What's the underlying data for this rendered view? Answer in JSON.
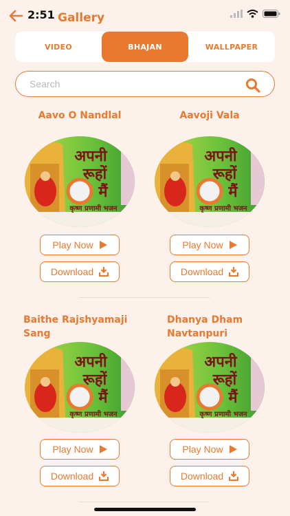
{
  "status": {
    "time": "2:51"
  },
  "header": {
    "title": "Gallery"
  },
  "tabs": [
    {
      "label": "VIDEO",
      "active": false
    },
    {
      "label": "BHAJAN",
      "active": true
    },
    {
      "label": "WALLPAPER",
      "active": false
    }
  ],
  "search": {
    "placeholder": "Search",
    "value": ""
  },
  "items": [
    {
      "title": "Aavo O Nandlal",
      "play_label": "Play Now",
      "download_label": "Download"
    },
    {
      "title": "Aavoji Vala",
      "play_label": "Play Now",
      "download_label": "Download"
    },
    {
      "title": "Baithe Rajshyamaji Sang",
      "play_label": "Play Now",
      "download_label": "Download"
    },
    {
      "title": "Dhanya Dham Navtanpuri",
      "play_label": "Play Now",
      "download_label": "Download"
    }
  ],
  "cover": {
    "line1": "अपनी",
    "line2": "रूहों",
    "line3": "मैं",
    "caption": "कृष्ण प्रणामी भजन"
  },
  "colors": {
    "accent": "#e8792f",
    "background": "#fdf1ec"
  }
}
